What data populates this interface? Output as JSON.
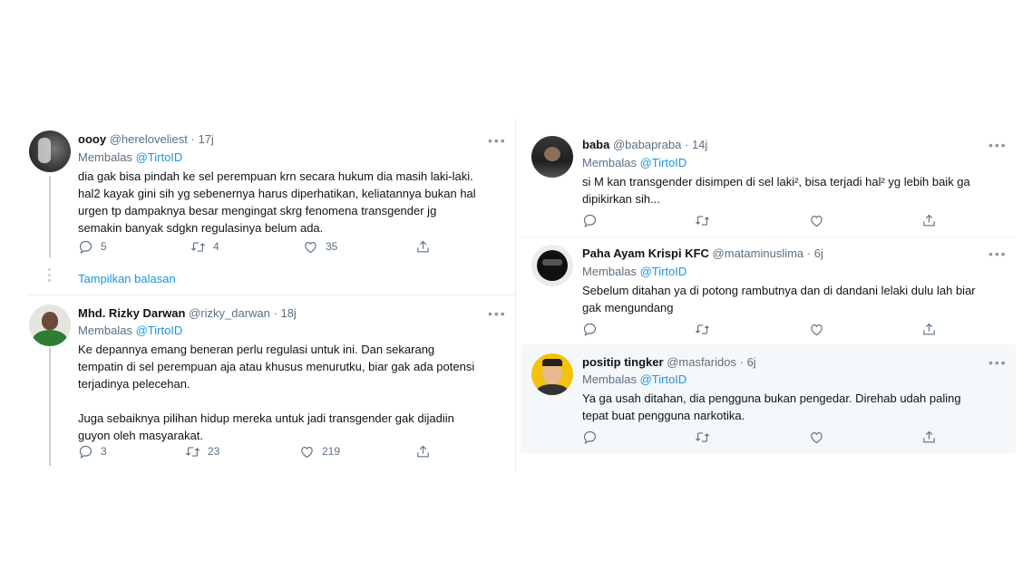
{
  "left": {
    "tweet1": {
      "name": "oooy",
      "handle": "@hereloveliest",
      "time": "17j",
      "reply_prefix": "Membalas",
      "reply_to": "@TirtoID",
      "text": "dia gak bisa pindah ke sel perempuan krn secara hukum dia masih laki-laki.\nhal2 kayak gini sih yg sebenernya harus diperhatikan, keliatannya bukan hal\nurgen tp dampaknya besar mengingat skrg fenomena transgender jg\nsemakin banyak sdgkn regulasinya belum ada.",
      "replies": "5",
      "retweets": "4",
      "likes": "35"
    },
    "show_replies": "Tampilkan balasan",
    "tweet2": {
      "name": "Mhd. Rizky Darwan",
      "handle": "@rizky_darwan",
      "time": "18j",
      "reply_prefix": "Membalas",
      "reply_to": "@TirtoID",
      "text": "Ke depannya emang beneran perlu regulasi untuk ini. Dan sekarang\ntempatin di sel perempuan aja atau khusus menurutku, biar gak ada potensi\nterjadinya pelecehan.\n\nJuga sebaiknya pilihan hidup mereka untuk jadi transgender gak dijadiin\nguyon oleh masyarakat.",
      "replies": "3",
      "retweets": "23",
      "likes": "219"
    }
  },
  "right": {
    "tweet1": {
      "name": "baba",
      "handle": "@babapraba",
      "time": "14j",
      "reply_prefix": "Membalas",
      "reply_to": "@TirtoID",
      "text": "si M kan transgender disimpen di sel laki², bisa terjadi hal² yg lebih baik ga\ndipikirkan sih..."
    },
    "tweet2": {
      "name": "Paha Ayam Krispi KFC",
      "handle": "@mataminuslima",
      "time": "6j",
      "reply_prefix": "Membalas",
      "reply_to": "@TirtoID",
      "text": "Sebelum ditahan ya di potong rambutnya dan di dandani lelaki dulu lah biar\ngak mengundang"
    },
    "tweet3": {
      "name": "positip tingker",
      "handle": "@masfaridos",
      "time": "6j",
      "reply_prefix": "Membalas",
      "reply_to": "@TirtoID",
      "text": "Ya ga usah ditahan, dia pengguna bukan pengedar. Direhab udah paling\ntepat buat pengguna narkotika."
    }
  },
  "icons": {
    "reply": "reply-icon",
    "retweet": "retweet-icon",
    "like": "heart-icon",
    "share": "share-icon",
    "more": "more-icon"
  },
  "colors": {
    "link": "#1b95e0",
    "secondary": "#5b7083",
    "highlight_bg": "#f5f8fa"
  }
}
